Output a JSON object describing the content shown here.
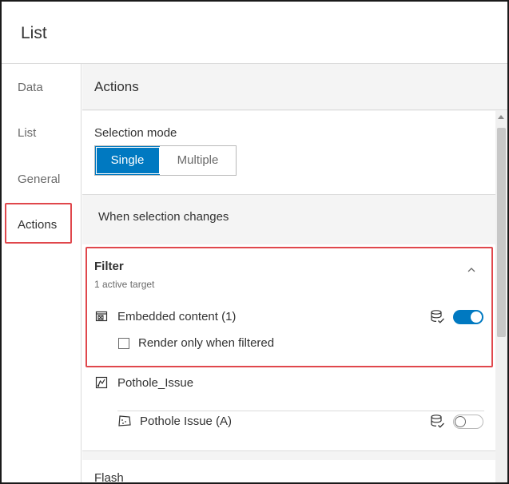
{
  "header": {
    "title": "List"
  },
  "nav": {
    "items": [
      {
        "label": "Data"
      },
      {
        "label": "List"
      },
      {
        "label": "General"
      },
      {
        "label": "Actions"
      }
    ],
    "active": "Actions"
  },
  "panel": {
    "title": "Actions",
    "selection_mode": {
      "label": "Selection mode",
      "options": [
        "Single",
        "Multiple"
      ],
      "selected": "Single"
    },
    "when_selection_changes": "When selection changes",
    "filter": {
      "title": "Filter",
      "subtitle": "1 active target",
      "targets": [
        {
          "label": "Embedded content (1)",
          "enabled": true,
          "icon": "embedded-content-icon"
        },
        {
          "label": "Render only when filtered",
          "checked": false
        }
      ]
    },
    "layer": {
      "label": "Pothole_Issue",
      "icon": "map-layer-icon",
      "sublayers": [
        {
          "label": "Pothole Issue (A)",
          "enabled": false,
          "icon": "polygon-layer-icon"
        }
      ]
    },
    "flash": {
      "label": "Flash"
    }
  },
  "colors": {
    "accent": "#0079c1",
    "highlight": "#e0474c"
  }
}
